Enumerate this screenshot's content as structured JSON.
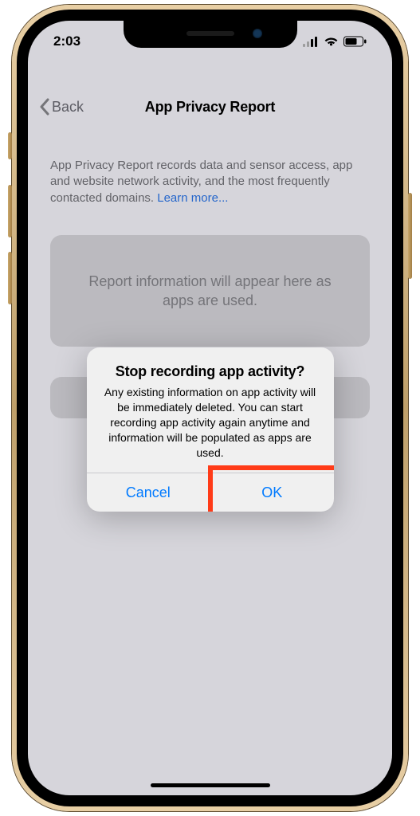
{
  "status": {
    "time": "2:03"
  },
  "nav": {
    "back": "Back",
    "title": "App Privacy Report"
  },
  "main": {
    "description": "App Privacy Report records data and sensor access, app and website network activity, and the most frequently contacted domains. ",
    "learn_more": "Learn more...",
    "placeholder_card": "Report information will appear here as apps are used."
  },
  "alert": {
    "title": "Stop recording app activity?",
    "message": "Any existing information on app activity will be immediately deleted. You can start recording app activity again anytime and information will be populated as apps are used.",
    "cancel": "Cancel",
    "ok": "OK"
  },
  "highlight": {
    "target": "alert-ok-button"
  }
}
